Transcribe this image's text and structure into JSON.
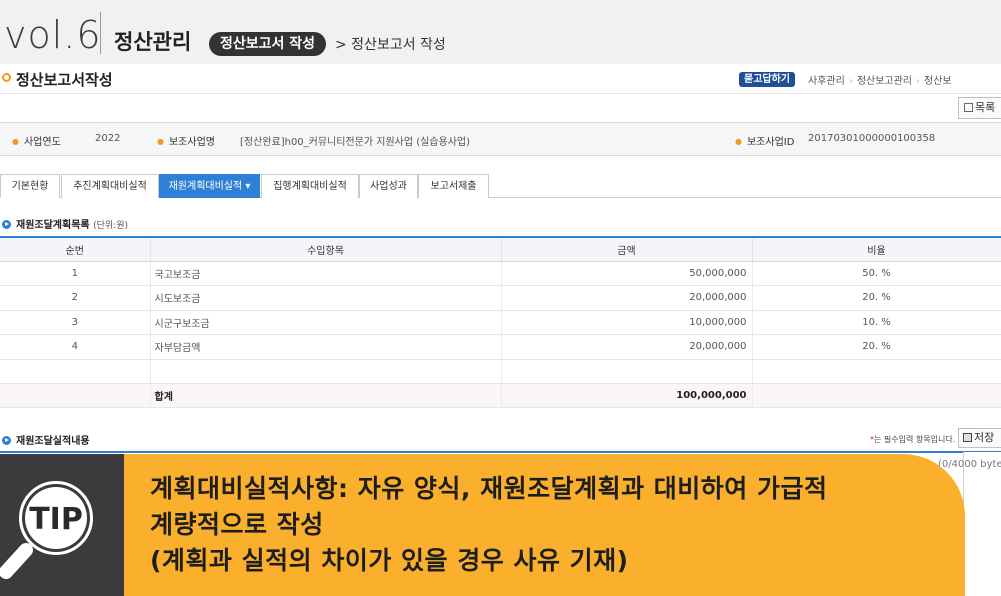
{
  "banner": {
    "vol": "vol.6",
    "title": "정산관리",
    "pill": "정산보고서 작성",
    "crumb": "> 정산보고서 작성"
  },
  "page": {
    "title": "정산보고서작성",
    "qa_button": "묻고답하기",
    "breadcrumb": [
      "사후관리",
      "정산보고관리",
      "정산보"
    ],
    "list_button": "목록"
  },
  "info": {
    "year_label": "사업연도",
    "year_value": "2022",
    "project_label": "보조사업명",
    "project_value": "[정산완료]h00_커뮤니티전문가 지원사업 (실습용사업)",
    "id_label": "보조사업ID",
    "id_value": "20170301000000100358"
  },
  "tabs": [
    {
      "label": "기본현황"
    },
    {
      "label": "추진계획대비실적"
    },
    {
      "label": "재원계획대비실적 ▾"
    },
    {
      "label": "집행계획대비실적"
    },
    {
      "label": "사업성과"
    },
    {
      "label": "보고서제출"
    }
  ],
  "section1": {
    "title": "재원조달계획목록",
    "unit": "(단위:원)"
  },
  "table": {
    "headers": [
      "순번",
      "수입항목",
      "금액",
      "비율"
    ],
    "rows": [
      {
        "no": "1",
        "item": "국고보조금",
        "amount": "50,000,000",
        "ratio": "50. %"
      },
      {
        "no": "2",
        "item": "시도보조금",
        "amount": "20,000,000",
        "ratio": "20. %"
      },
      {
        "no": "3",
        "item": "시군구보조금",
        "amount": "10,000,000",
        "ratio": "10. %"
      },
      {
        "no": "4",
        "item": "자부담금액",
        "amount": "20,000,000",
        "ratio": "20. %"
      }
    ],
    "total_label": "합계",
    "total_amount": "100,000,000"
  },
  "section2": {
    "title": "재원조달실적내용",
    "required_note": "는 필수입력 항목입니다.",
    "required_star": "*",
    "save_button": "저장",
    "byte_counter": "(0/4000 byte)"
  },
  "tip": {
    "badge": "TIP",
    "line1": "계획대비실적사항: 자유 양식, 재원조달계획과 대비하여 가급적",
    "line2": "계량적으로 작성",
    "line3": "(계획과 실적의 차이가 있을 경우 사유 기재)"
  },
  "colors": {
    "accent": "#2e80d4",
    "tip_yellow": "#fbb02d",
    "tip_dark": "#3b3b3b",
    "orange": "#f29b1b"
  }
}
